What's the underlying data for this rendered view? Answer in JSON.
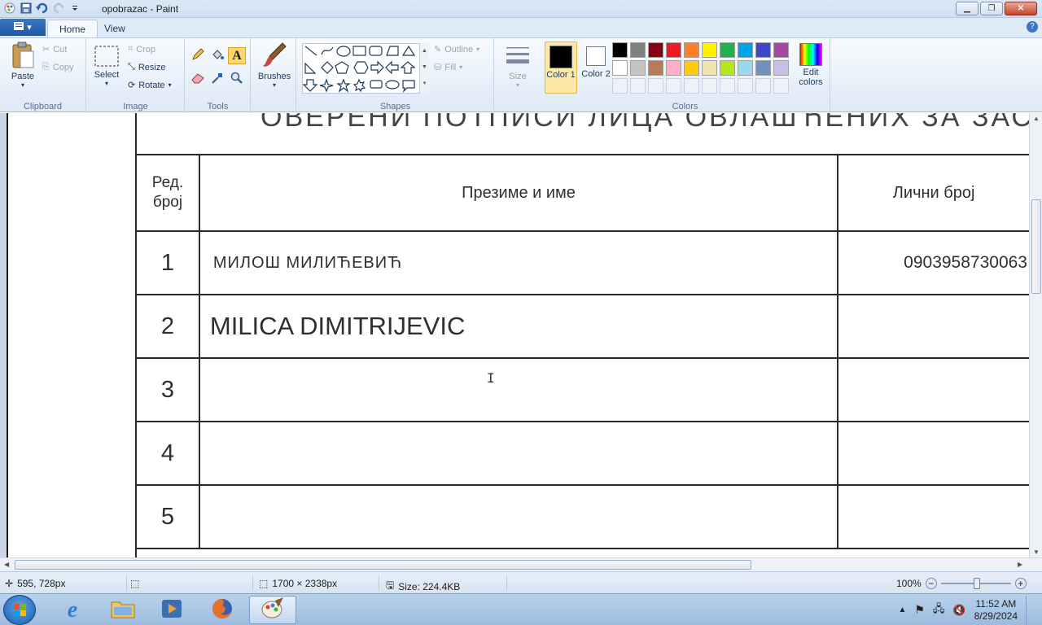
{
  "window": {
    "title": "opobrazac - Paint"
  },
  "tabs": {
    "home": "Home",
    "view": "View"
  },
  "ribbon": {
    "clipboard": {
      "label": "Clipboard",
      "paste": "Paste",
      "cut": "Cut",
      "copy": "Copy"
    },
    "image": {
      "label": "Image",
      "select": "Select",
      "crop": "Crop",
      "resize": "Resize",
      "rotate": "Rotate"
    },
    "tools": {
      "label": "Tools"
    },
    "brushes": {
      "label": "Brushes"
    },
    "shapes": {
      "label": "Shapes",
      "outline": "Outline",
      "fill": "Fill"
    },
    "size": {
      "label": "Size"
    },
    "colors": {
      "label": "Colors",
      "color1": "Color 1",
      "color2": "Color 2",
      "edit": "Edit colors",
      "palette_row1": [
        "#000000",
        "#7f7f7f",
        "#880015",
        "#ed1c24",
        "#ff7f27",
        "#fff200",
        "#22b14c",
        "#00a2e8",
        "#3f48cc",
        "#a349a4"
      ],
      "palette_row2": [
        "#ffffff",
        "#c3c3c3",
        "#b97a57",
        "#ffaec9",
        "#ffc90e",
        "#efe4b0",
        "#b5e61d",
        "#99d9ea",
        "#7092be",
        "#c8bfe7"
      ]
    }
  },
  "document": {
    "heading": "ОВЕРЕНИ ПОТПИСИ ЛИЦА ОВЛАШЋЕНИХ ЗА ЗАС",
    "headers": {
      "no_line1": "Ред.",
      "no_line2": "број",
      "name": "Презиме и име",
      "id": "Лични број"
    },
    "rows": [
      {
        "no": "1",
        "name": "МИЛОШ  МИЛИЋЕВИЋ",
        "id": "0903958730063"
      },
      {
        "no": "2",
        "name": "MILICA DIMITRIJEVIC",
        "id": ""
      },
      {
        "no": "3",
        "name": "",
        "id": ""
      },
      {
        "no": "4",
        "name": "",
        "id": ""
      },
      {
        "no": "5",
        "name": "",
        "id": ""
      }
    ]
  },
  "status": {
    "cursor": "595, 728px",
    "dimensions": "1700 × 2338px",
    "size": "Size: 224.4KB",
    "zoom": "100%"
  },
  "taskbar": {
    "time": "11:52 AM",
    "date": "8/29/2024"
  }
}
